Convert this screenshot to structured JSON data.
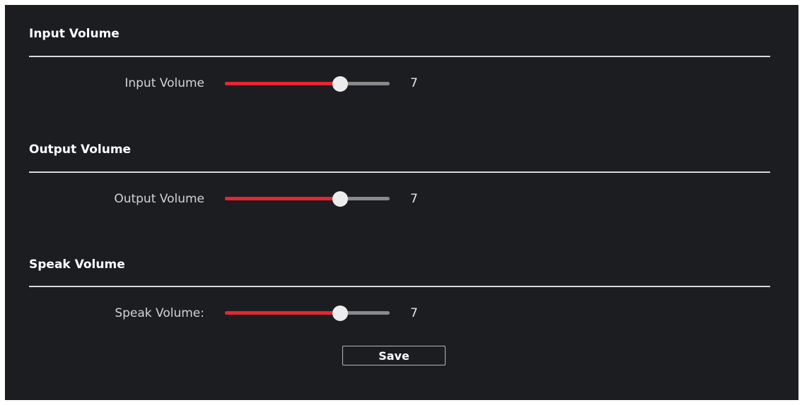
{
  "sections": [
    {
      "title": "Input Volume",
      "row": {
        "label": "Input Volume",
        "value": "7",
        "level": 7,
        "max": 10
      }
    },
    {
      "title": "Output Volume",
      "row": {
        "label": "Output Volume",
        "value": "7",
        "level": 7,
        "max": 10
      }
    },
    {
      "title": "Speak Volume",
      "row": {
        "label": "Speak Volume:",
        "value": "7",
        "level": 7,
        "max": 10
      }
    }
  ],
  "actions": {
    "save_label": "Save"
  },
  "colors": {
    "background": "#1c1d21",
    "slider_fill": "#e8262f",
    "slider_track": "#8a8a8a",
    "slider_thumb": "#ececec"
  }
}
